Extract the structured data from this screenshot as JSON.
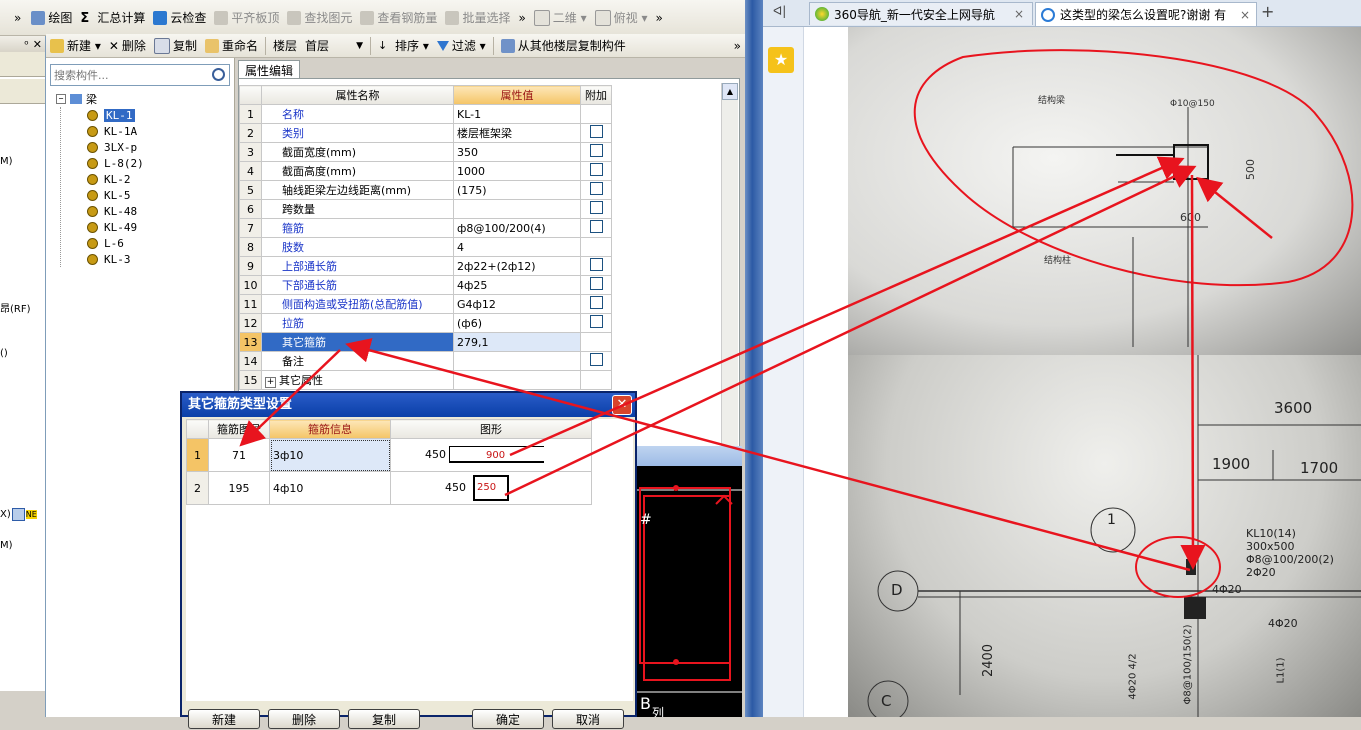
{
  "toolbar1": {
    "chev": "»",
    "draw": "绘图",
    "sum": "汇总计算",
    "cloud_check": "云检查",
    "flat_top": "平齐板顶",
    "find_element": "查找图元",
    "view_rebar": "查看钢筋量",
    "batch_select": "批量选择",
    "chev2": "»",
    "view_mode": "二维",
    "view_angle": "俯视",
    "chev3": "»"
  },
  "toolbar2": {
    "new": "新建",
    "delete": "删除",
    "copy": "复制",
    "rename": "重命名",
    "floor_label": "楼层",
    "floor_value": "首层",
    "sort": "排序",
    "filter": "过滤",
    "copy_from_floor": "从其他楼层复制构件",
    "chev": "»"
  },
  "left_panel": {
    "pin": "ᵒ",
    "close": "✕",
    "items": [
      "M)",
      "昂(RF)",
      "()",
      "X)",
      "NE",
      "M)"
    ]
  },
  "search": {
    "placeholder": "搜索构件..."
  },
  "tree": {
    "root": "梁",
    "items": [
      "KL-1",
      "KL-1A",
      "3LX-p",
      "L-8(2)",
      "KL-2",
      "KL-5",
      "KL-48",
      "KL-49",
      "L-6",
      "KL-3"
    ]
  },
  "props": {
    "tab": "属性编辑",
    "col_name": "属性名称",
    "col_value": "属性值",
    "col_extra": "附加",
    "rows": [
      {
        "no": "1",
        "name": "名称",
        "value": "KL-1",
        "blue": true,
        "chk": false
      },
      {
        "no": "2",
        "name": "类别",
        "value": "楼层框架梁",
        "blue": true,
        "chk": true
      },
      {
        "no": "3",
        "name": "截面宽度(mm)",
        "value": "350",
        "blue": false,
        "chk": true
      },
      {
        "no": "4",
        "name": "截面高度(mm)",
        "value": "1000",
        "blue": false,
        "chk": true
      },
      {
        "no": "5",
        "name": "轴线距梁左边线距离(mm)",
        "value": "(175)",
        "blue": false,
        "chk": true
      },
      {
        "no": "6",
        "name": "跨数量",
        "value": "",
        "blue": false,
        "chk": true
      },
      {
        "no": "7",
        "name": "箍筋",
        "value": "ф8@100/200(4)",
        "blue": true,
        "chk": true
      },
      {
        "no": "8",
        "name": "肢数",
        "value": "4",
        "blue": true,
        "chk": false
      },
      {
        "no": "9",
        "name": "上部通长筋",
        "value": "2ф22+(2ф12)",
        "blue": true,
        "chk": true
      },
      {
        "no": "10",
        "name": "下部通长筋",
        "value": "4ф25",
        "blue": true,
        "chk": true
      },
      {
        "no": "11",
        "name": "侧面构造或受扭筋(总配筋值)",
        "value": "G4ф12",
        "blue": true,
        "chk": true
      },
      {
        "no": "12",
        "name": "拉筋",
        "value": "(ф6)",
        "blue": true,
        "chk": true
      },
      {
        "no": "13",
        "name": "其它箍筋",
        "value": "279,1",
        "blue": false,
        "chk": false
      },
      {
        "no": "14",
        "name": "备注",
        "value": "",
        "blue": false,
        "chk": true
      },
      {
        "no": "15",
        "name": "其它属性",
        "value": "",
        "blue": false,
        "chk": false
      }
    ]
  },
  "dialog": {
    "title": "其它箍筋类型设置",
    "col_no": "箍筋图号",
    "col_info": "箍筋信息",
    "col_shape": "图形",
    "rows": [
      {
        "idx": "1",
        "no": "71",
        "info": "3ф10",
        "dim1": "450",
        "dim2": "900"
      },
      {
        "idx": "2",
        "no": "195",
        "info": "4ф10",
        "dim1": "450",
        "dim2": "250"
      }
    ],
    "btn_new": "新建",
    "btn_delete": "删除",
    "btn_copy": "复制",
    "btn_ok": "确定",
    "btn_cancel": "取消"
  },
  "cad": {
    "hash": "#",
    "letter": "B",
    "letter2": "列"
  },
  "browser": {
    "back": "ᐊ|",
    "tab1": "360导航_新一代安全上网导航",
    "tab2": "这类型的梁怎么设置呢?谢谢 有",
    "tab_close": "×",
    "new_tab": "+"
  },
  "photo": {
    "top": {
      "label1": "结构梁",
      "label2": "Φ10@150",
      "dim500": "500",
      "dim600": "600",
      "label3": "结构柱"
    },
    "bottom": {
      "dim3600": "3600",
      "dim1900": "1900",
      "dim1700": "1700",
      "circle1": "1",
      "circleD": "D",
      "circleC": "C",
      "kl1": "KL10(14)",
      "kl2": "300x500",
      "kl3": "Φ8@100/200(2)",
      "kl4": "2Φ20",
      "r1": "4Φ20",
      "r2": "4Φ20",
      "dim2400": "2400",
      "v1": "Φ8@100/150(2)",
      "v2": "4Φ20 4/2",
      "v3": "L1(1)"
    }
  },
  "colors": {
    "arrow": "#e8141e",
    "selection": "#316ac5",
    "dialog_title": "#0a246a"
  }
}
